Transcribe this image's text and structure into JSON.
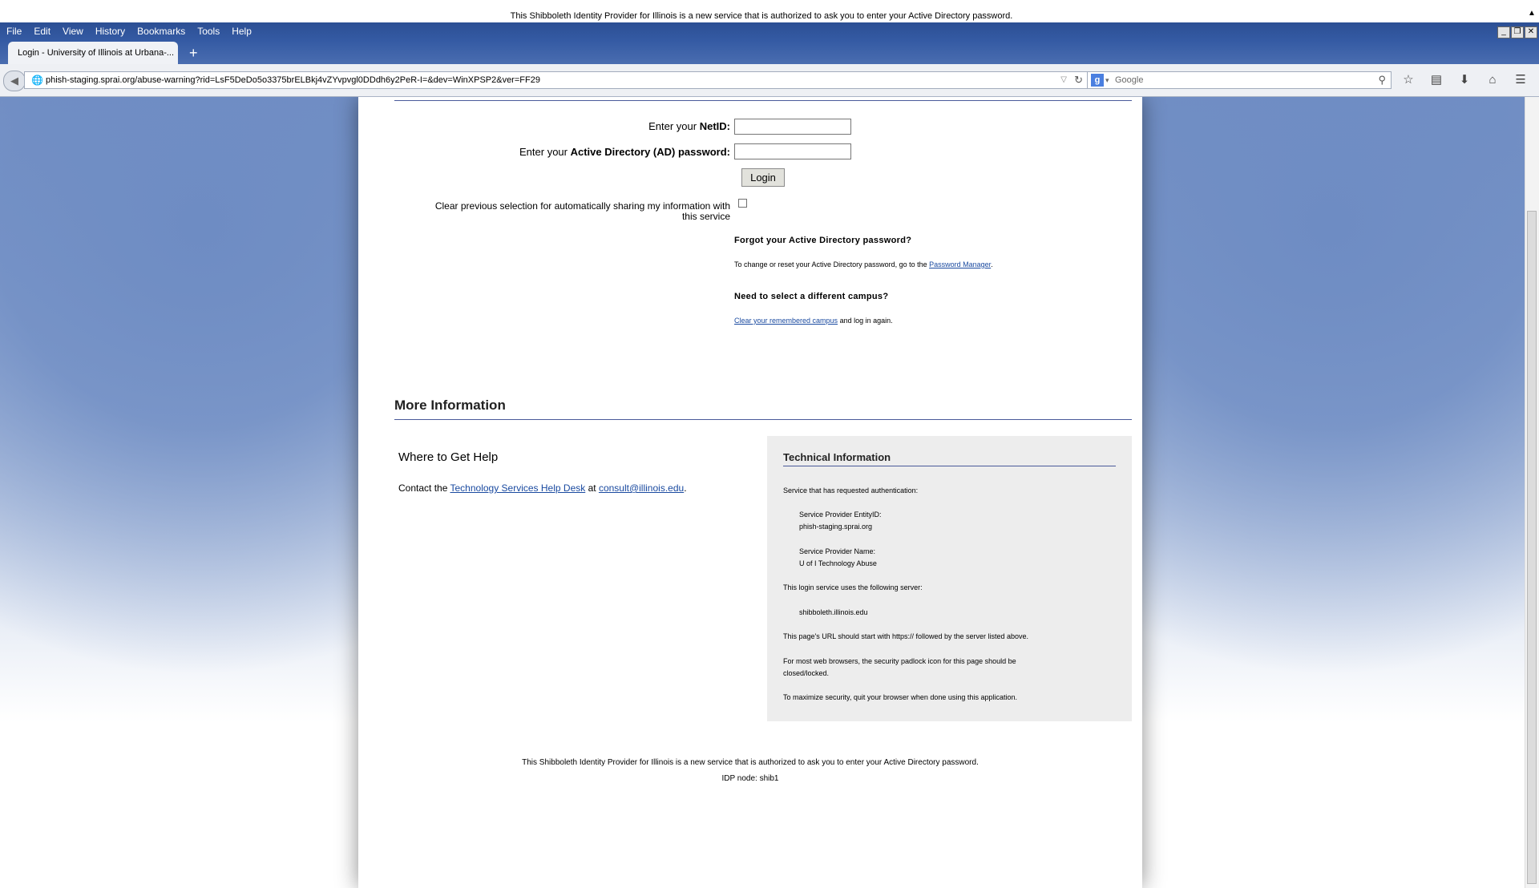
{
  "top_notice": "This Shibboleth Identity Provider for Illinois is a new service that is authorized to ask you to enter your Active Directory password.",
  "menubar": {
    "items": [
      "File",
      "Edit",
      "View",
      "History",
      "Bookmarks",
      "Tools",
      "Help"
    ]
  },
  "tab": {
    "title": "Login - University of Illinois at Urbana-...",
    "new_tab": "+"
  },
  "navbar": {
    "url": "phish-staging.sprai.org/abuse-warning?rid=LsF5DeDo5o3375brELBkj4vZYvpvgl0DDdh6y2PeR-I=&dev=WinXPSP2&ver=FF29",
    "search_placeholder": "Google",
    "search_engine": "g"
  },
  "login": {
    "netid_prefix": "Enter your ",
    "netid_bold": "NetID:",
    "password_prefix": "Enter your ",
    "password_bold": "Active Directory (AD) password:",
    "login_button": "Login",
    "clear_selection_line1": "Clear previous selection for automatically sharing my information with",
    "clear_selection_line2": "this service",
    "forgot_title": "Forgot your Active Directory password?",
    "forgot_text": "To change or reset your Active Directory password, go to the ",
    "forgot_link": "Password Manager",
    "forgot_end": ".",
    "campus_title": "Need to select a different campus?",
    "campus_link": "Clear your remembered campus",
    "campus_text": " and log in again."
  },
  "more_info": {
    "title": "More Information",
    "help_title": "Where to Get Help",
    "help_prefix": "Contact the ",
    "help_link": "Technology Services Help Desk",
    "help_mid": " at ",
    "help_email": "consult@illinois.edu",
    "help_end": ".",
    "tech_title": "Technical Information",
    "tech_service_req": "Service that has requested authentication:",
    "sp_entity_label": "Service Provider EntityID:",
    "sp_entity_value": "phish-staging.sprai.org",
    "sp_name_label": "Service Provider Name:",
    "sp_name_value": "U of I Technology Abuse",
    "server_intro": "This login service uses the following server:",
    "server_value": "shibboleth.illinois.edu",
    "url_note": "This page's URL should start with https:// followed by the server listed above.",
    "padlock_line1": "For most web browsers, the security padlock icon for this page should be",
    "padlock_line2": "closed/locked.",
    "security_note": "To maximize security, quit your browser when done using this application."
  },
  "footer": {
    "notice": "This Shibboleth Identity Provider for Illinois is a new service that is authorized to ask you to enter your Active Directory password.",
    "node": "IDP node: shib1"
  }
}
